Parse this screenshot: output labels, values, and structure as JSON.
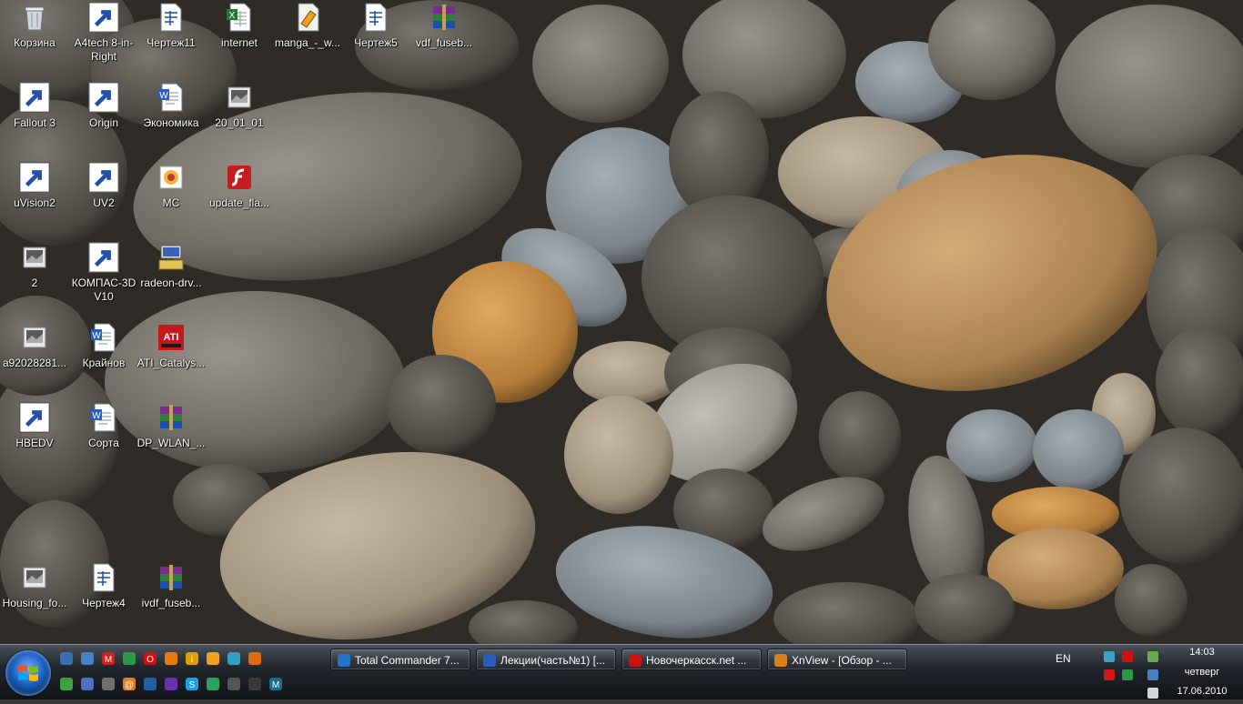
{
  "desktop": {
    "icons": [
      {
        "label": "Корзина",
        "icon": "recycle-bin-icon"
      },
      {
        "label": "A4tech 8-in-Right",
        "icon": "a4tech-app-icon"
      },
      {
        "label": "Чертеж11",
        "icon": "drawing-doc-icon"
      },
      {
        "label": "internet",
        "icon": "excel-doc-icon"
      },
      {
        "label": "manga_-_w...",
        "icon": "djvu-doc-icon"
      },
      {
        "label": "Чертеж5",
        "icon": "drawing-doc-icon"
      },
      {
        "label": "vdf_fuseb...",
        "icon": "rar-archive-icon"
      },
      {
        "label": "Fallout 3",
        "icon": "fallout-game-icon"
      },
      {
        "label": "Origin",
        "icon": "origin-app-icon"
      },
      {
        "label": "Экономика",
        "icon": "word-doc-icon"
      },
      {
        "label": "20_01_01",
        "icon": "image-file-icon"
      },
      {
        "label": "uVision2",
        "icon": "folder-icon"
      },
      {
        "label": "UV2",
        "icon": "uv2-app-icon"
      },
      {
        "label": "MC",
        "icon": "mc-app-icon"
      },
      {
        "label": "update_fla...",
        "icon": "flash-installer-icon"
      },
      {
        "label": "2",
        "icon": "image-file-icon"
      },
      {
        "label": "КОМПАС-3D V10",
        "icon": "kompas-app-icon"
      },
      {
        "label": "radeon-drv...",
        "icon": "installer-icon"
      },
      {
        "label": "a92028281...",
        "icon": "image-file-icon"
      },
      {
        "label": "Крайнов",
        "icon": "word-doc-icon"
      },
      {
        "label": "ATI_Catalys...",
        "icon": "ati-radeon-icon"
      },
      {
        "label": "HBEDV",
        "icon": "hbedv-app-icon"
      },
      {
        "label": "Сорта",
        "icon": "word-doc-icon"
      },
      {
        "label": "DP_WLAN_...",
        "icon": "rar-archive-icon"
      },
      {
        "label": "Housing_fo...",
        "icon": "image-file-icon"
      },
      {
        "label": "Чертеж4",
        "icon": "drawing-doc-icon"
      },
      {
        "label": "ivdf_fuseb...",
        "icon": "rar-archive-icon"
      }
    ]
  },
  "taskbar": {
    "start_icon": "windows-orb-icon",
    "quick_launch": [
      "show-desktop-icon",
      "computer-icon",
      "metro-icon",
      "calculator-icon",
      "opera-icon",
      "avast-icon",
      "info-icon",
      "crown-icon",
      "network-icon",
      "firefox-icon",
      "utorrent-icon",
      "tool-icon",
      "scissors-icon",
      "email-at-icon",
      "connection-icon",
      "purple-app-icon",
      "skype-icon",
      "game-icon",
      "app-icon",
      "winamp-icon",
      "m-app-icon"
    ],
    "tasks": [
      {
        "label": "Total Commander 7...",
        "icon": "total-commander-icon"
      },
      {
        "label": "Лекции(часть№1) [...",
        "icon": "word-doc-icon"
      },
      {
        "label": "Новочеркасск.net ...",
        "icon": "opera-icon"
      },
      {
        "label": "XnView - [Обзор - ...",
        "icon": "xnview-icon"
      }
    ],
    "language": "EN",
    "tray_icons": [
      "network-tray-icon",
      "opera-tray-icon",
      "antivirus-tray-icon",
      "gpu-tray-icon",
      "battery-tray-icon",
      "display-tray-icon",
      "volume-tray-icon"
    ],
    "clock": {
      "time": "14:03",
      "day": "четверг",
      "date": "17.06.2010"
    }
  },
  "colors": {
    "taskbar": "#23272d",
    "label_text": "#ffffff",
    "start_orb": "#1b5fbf"
  }
}
